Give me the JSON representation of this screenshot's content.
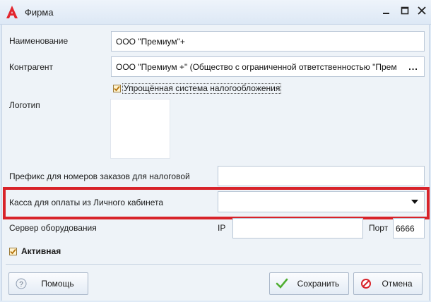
{
  "window": {
    "title": "Фирма",
    "controls": {
      "minimize": "minimize",
      "maximize": "maximize",
      "close": "close"
    }
  },
  "form": {
    "name": {
      "label": "Наименование",
      "value": "ООО \"Премиум\"+"
    },
    "counterparty": {
      "label": "Контрагент",
      "value": "ООО \"Премиум +\" (Общество с ограниченной ответственностью \"Прем",
      "button": "..."
    },
    "simplified_tax": {
      "label": "Упрощённая система налогообложения",
      "checked": true
    },
    "logo": {
      "label": "Логотип"
    },
    "order_prefix": {
      "label": "Префикс для номеров заказов для налоговой",
      "value": ""
    },
    "cash_desk": {
      "label": "Касса для оплаты из Личного кабинета",
      "value": ""
    },
    "equipment_server": {
      "label": "Сервер оборудования",
      "ip_label": "IP",
      "ip_value": "",
      "port_label": "Порт",
      "port_value": "6666"
    },
    "active": {
      "label": "Активная",
      "checked": true
    }
  },
  "buttons": {
    "help": "Помощь",
    "save": "Сохранить",
    "cancel": "Отмена"
  },
  "colors": {
    "highlight": "#d8232a",
    "accent": "#d8232a",
    "check": "#c98a17"
  }
}
